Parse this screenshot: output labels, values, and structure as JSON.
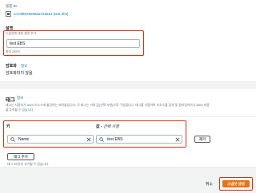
{
  "volume": {
    "id_label": "볼륨 ID",
    "id_value": "vol-0f6578e58da72ab31 (test ebs)"
  },
  "description": {
    "label": "설명",
    "placeholder": "스냅샷에 대한 설명 추가",
    "value": "test EBS",
    "hint": "최대 255자"
  },
  "encryption": {
    "label": "암호화",
    "info": "정보",
    "value": "암호화되지 않음"
  },
  "tags": {
    "title": "태그",
    "info": "정보",
    "description_line1": "태그는 사용자가 AWS 리소스에 할당하는 레이블입니다. 각 태그는 키와 값(선택 사항)으로 구성됩니다. 태그를 사용하여 리소스를 검색 및 필터링하거나 AWS 비용",
    "description_line2": "을 추적할 수 있습니다.",
    "key_label": "키",
    "value_label": "값 - ",
    "value_label_optional": "선택 사항",
    "key_value": "Name",
    "value_value": "test EBS",
    "remove_label": "제거",
    "add_label": "태그 추가",
    "limit_hint": "태그 49개 더 추가할 수 있습니다."
  },
  "footer": {
    "cancel_label": "취소",
    "create_label": "스냅샷 생성"
  },
  "colors": {
    "accent_orange": "#ec7211",
    "highlight_red": "#d13212",
    "link_blue": "#0073bb"
  }
}
